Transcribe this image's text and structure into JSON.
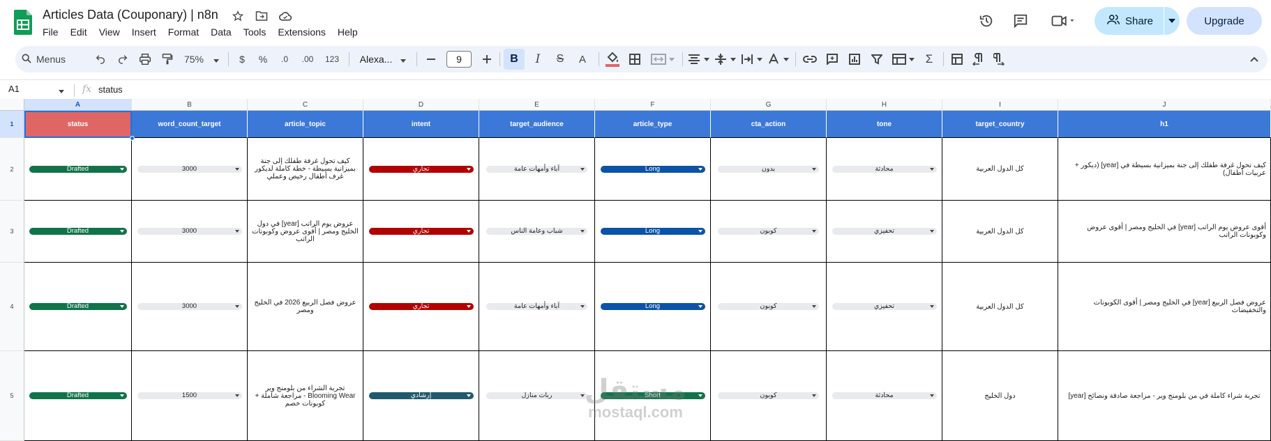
{
  "doc": {
    "title": "Articles Data (Couponary) | n8n"
  },
  "menu": [
    "File",
    "Edit",
    "View",
    "Insert",
    "Format",
    "Data",
    "Tools",
    "Extensions",
    "Help"
  ],
  "actions": {
    "share": "Share",
    "upgrade": "Upgrade"
  },
  "toolbar": {
    "search": "Menus",
    "zoom": "75%",
    "currency": "$",
    "percent": "%",
    "dec_decrease": ".0",
    "dec_increase": ".00",
    "number_format": "123",
    "font": "Alexa...",
    "font_size": "9"
  },
  "formula": {
    "cell_ref": "A1",
    "fx": "fx",
    "value": "status"
  },
  "columns": [
    "A",
    "B",
    "C",
    "D",
    "E",
    "F",
    "G",
    "H",
    "I",
    "J"
  ],
  "row_numbers": [
    "1",
    "2",
    "3",
    "4",
    "5"
  ],
  "headers": [
    "status",
    "word_count_target",
    "article_topic",
    "intent",
    "target_audience",
    "article_type",
    "cta_action",
    "tone",
    "target_country",
    "h1"
  ],
  "rows": [
    {
      "status": "Drafted",
      "word_count_target": "3000",
      "article_topic": "كيف تحول غرفة طفلك إلى جنة بميزانية بسيطة - خطة كاملة لديكور غرف أطفال رخيص وعملي",
      "intent": "تجاري",
      "target_audience": "آباء وأمهات عامة",
      "article_type": "Long",
      "cta_action": "بدون",
      "tone": "محادثة",
      "target_country": "كل الدول العربية",
      "h1": "كيف تحول غرفة طفلك إلى جنة بميزانية بسيطة في [year] (ديكور + عربيات أطفال)"
    },
    {
      "status": "Drafted",
      "word_count_target": "3000",
      "article_topic": "عروض يوم الراتب [year] في دول الخليج ومصر | أقوى عروض وكوبونات الراتب",
      "intent": "تجاري",
      "target_audience": "شباب وعامة الناس",
      "article_type": "Long",
      "cta_action": "كوبون",
      "tone": "تحفيزي",
      "target_country": "كل الدول العربية",
      "h1": "أقوى عروض يوم الراتب [year] في الخليج ومصر | أقوى عروض وكوبونات الراتب"
    },
    {
      "status": "Drafted",
      "word_count_target": "3000",
      "article_topic": "عروض فصل الربيع 2026 في الخليج ومصر",
      "intent": "تجاري",
      "target_audience": "آباء وأمهات عامة",
      "article_type": "Long",
      "cta_action": "كوبون",
      "tone": "تحفيزي",
      "target_country": "كل الدول العربية",
      "h1": "عروض فصل الربيع [year] في الخليج ومصر | أقوى الكوبونات والتخفيضات"
    },
    {
      "status": "Drafted",
      "word_count_target": "1500",
      "article_topic": "تجربة الشراء من بلومنج وير Blooming Wear - مراجعة شاملة + كوبونات خصم",
      "intent": "إرشادي",
      "target_audience": "ربات منازل",
      "article_type": "Short",
      "cta_action": "كوبون",
      "tone": "محادثة",
      "target_country": "دول الخليج",
      "h1": "تجربة شراء كاملة في من بلومنج وير - مراجعة صادقة ونصائح [year]"
    }
  ],
  "watermark": {
    "arabic": "مستقل",
    "latin": "mostaql.com"
  },
  "colors": {
    "header_blue": "#3c78d8",
    "status_header_red": "#e06666",
    "chip_green": "#11734b",
    "chip_red": "#b10202",
    "chip_blue": "#0a53a8",
    "chip_teal": "#215a6c",
    "share_bg": "#c2e7ff",
    "upgrade_bg": "#d3e3fd"
  }
}
